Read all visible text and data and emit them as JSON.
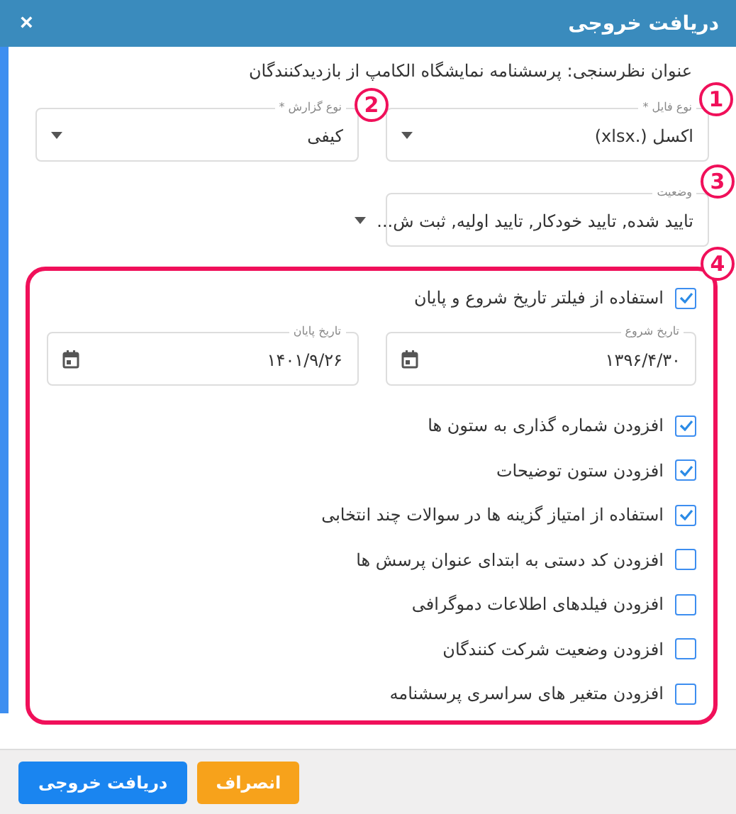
{
  "window": {
    "title": "دریافت خروجی",
    "close": "×"
  },
  "survey_title": "عنوان نظرسنجی: پرسشنامه نمایشگاه الکامپ از بازدیدکنندگان",
  "fields": [
    {
      "kind": "select",
      "label": "نوع فایل *",
      "value": "اکسل (.xlsx)"
    },
    {
      "kind": "select",
      "label": "نوع گزارش *",
      "value": "کیفی"
    },
    {
      "kind": "select",
      "label": "وضعیت",
      "value": "تایید شده, تایید خودکار, تایید اولیه, ثبت ش..."
    }
  ],
  "date_filter": {
    "label": "استفاده از فیلتر تاریخ شروع و پایان",
    "checked": true,
    "dates": [
      {
        "label": "تاریخ شروع",
        "value": "۱۳۹۶/۴/۳۰"
      },
      {
        "label": "تاریخ پایان",
        "value": "۱۴۰۱/۹/۲۶"
      }
    ]
  },
  "options": [
    {
      "label": "افزودن شماره گذاری به ستون ها",
      "checked": true
    },
    {
      "label": "افزودن ستون توضیحات",
      "checked": true
    },
    {
      "label": "استفاده از امتیاز گزینه ها در سوالات چند انتخابی",
      "checked": true
    },
    {
      "label": "افزودن کد دستی به ابتدای عنوان پرسش ها",
      "checked": false
    },
    {
      "label": "افزودن فیلدهای اطلاعات دموگرافی",
      "checked": false
    },
    {
      "label": "افزودن وضعیت شرکت کنندگان",
      "checked": false
    },
    {
      "label": "افزودن متغیر های سراسری پرسشنامه",
      "checked": false
    }
  ],
  "markers": [
    "1",
    "2",
    "3",
    "4"
  ],
  "buttons": [
    {
      "kind": "cancel",
      "label": "انصراف"
    },
    {
      "kind": "primary",
      "label": "دریافت خروجی"
    }
  ]
}
